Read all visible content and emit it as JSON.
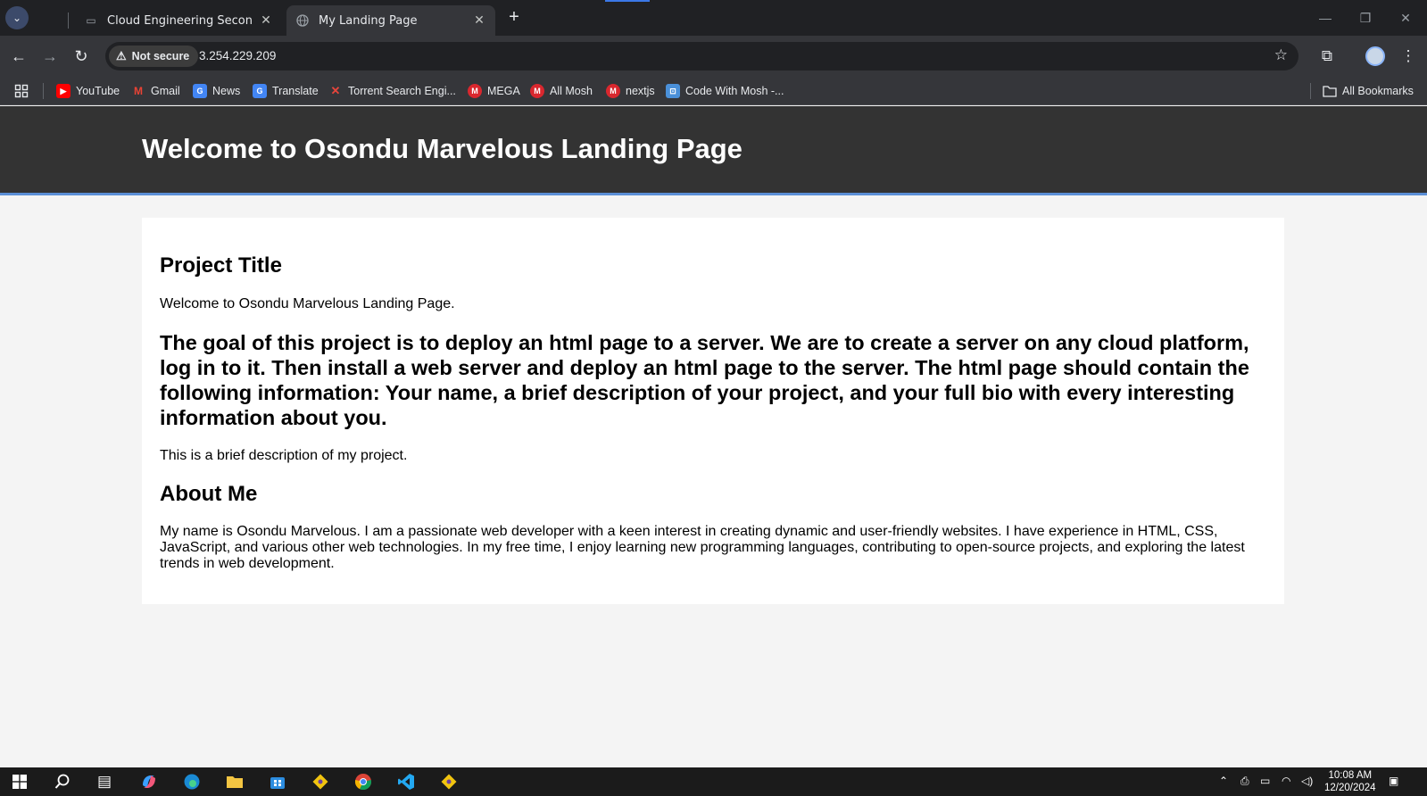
{
  "browser": {
    "tabs": [
      {
        "title": "Cloud Engineering Second Sem",
        "active": false
      },
      {
        "title": "My Landing Page",
        "active": true
      }
    ],
    "security_label": "Not secure",
    "url": "3.254.229.209"
  },
  "bookmarks": [
    {
      "label": "YouTube",
      "color": "#ff0000",
      "glyph": "▶"
    },
    {
      "label": "Gmail",
      "color": "#ea4335",
      "glyph": "M"
    },
    {
      "label": "News",
      "color": "#4285f4",
      "glyph": "G"
    },
    {
      "label": "Translate",
      "color": "#4285f4",
      "glyph": "G"
    },
    {
      "label": "Torrent Search Engi...",
      "color": "#e8453c",
      "glyph": "X"
    },
    {
      "label": "MEGA",
      "color": "#d9272e",
      "glyph": "M"
    },
    {
      "label": "All Mosh",
      "color": "#d9272e",
      "glyph": "M"
    },
    {
      "label": "nextjs",
      "color": "#d9272e",
      "glyph": "M"
    },
    {
      "label": "Code With Mosh -...",
      "color": "#4a90d9",
      "glyph": "⊡"
    }
  ],
  "all_bookmarks_label": "All Bookmarks",
  "page": {
    "header_title": "Welcome to Osondu Marvelous Landing Page",
    "project_heading": "Project Title",
    "welcome_text": "Welcome to Osondu Marvelous Landing Page.",
    "goal_text": "The goal of this project is to deploy an html page to a server. We are to create a server on any cloud platform, log in to it. Then install a web server and deploy an html page to the server. The html page should contain the following information: Your name, a brief description of your project, and your full bio with every interesting information about you.",
    "brief_text": "This is a brief description of my project.",
    "about_heading": "About Me",
    "bio_text": "My name is Osondu Marvelous. I am a passionate web developer with a keen interest in creating dynamic and user-friendly websites. I have experience in HTML, CSS, JavaScript, and various other web technologies. In my free time, I enjoy learning new programming languages, contributing to open-source projects, and exploring the latest trends in web development."
  },
  "taskbar": {
    "time": "10:08 AM",
    "date": "12/20/2024"
  },
  "colors": {
    "header_bg": "#333333",
    "header_border": "#5b8fd6",
    "page_bg": "#f4f4f4"
  }
}
